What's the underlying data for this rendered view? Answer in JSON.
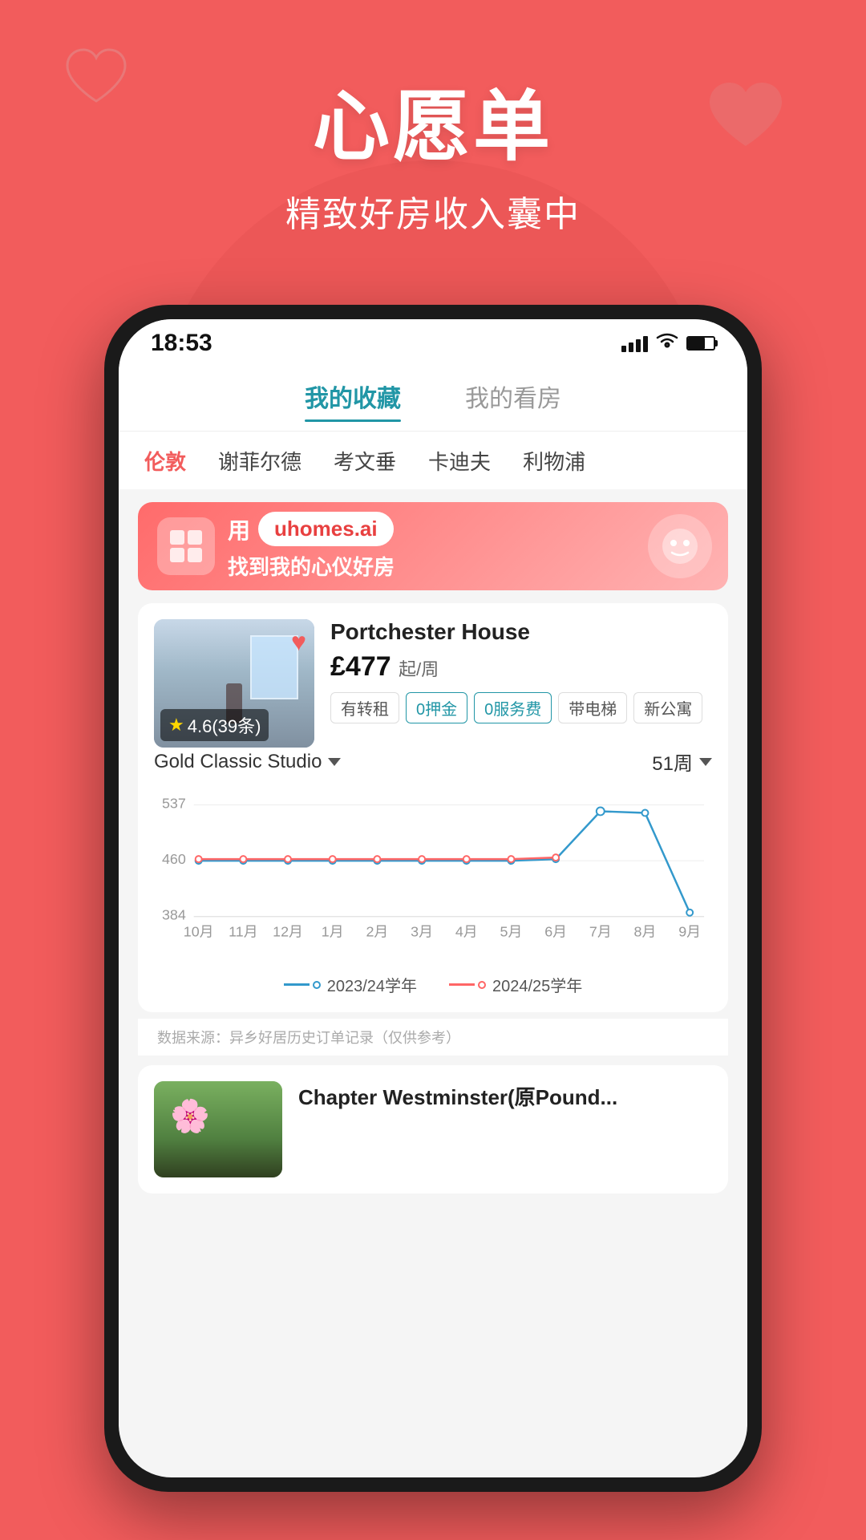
{
  "background_color": "#f25c5c",
  "header": {
    "title": "心愿单",
    "subtitle": "精致好房收入囊中"
  },
  "phone": {
    "status_bar": {
      "time": "18:53"
    },
    "tabs": [
      {
        "label": "我的收藏",
        "active": true
      },
      {
        "label": "我的看房",
        "active": false
      }
    ],
    "cities": [
      {
        "label": "伦敦",
        "active": true
      },
      {
        "label": "谢菲尔德",
        "active": false
      },
      {
        "label": "考文垂",
        "active": false
      },
      {
        "label": "卡迪夫",
        "active": false
      },
      {
        "label": "利物浦",
        "active": false
      }
    ],
    "banner": {
      "prefix_text": "用",
      "url": "uhomes.ai",
      "suffix_text": "找到我的心仪好房"
    },
    "property1": {
      "name": "Portchester House",
      "price": "£477",
      "price_suffix": "起/周",
      "rating": "4.6(39条)",
      "tags": [
        "有转租",
        "0押金",
        "0服务费",
        "带电梯",
        "新公寓"
      ],
      "room_type": "Gold Classic Studio",
      "week_count": "51周",
      "y_max": "537",
      "y_mid": "460",
      "y_min": "384",
      "x_labels": [
        "10月",
        "11月",
        "12月",
        "1月",
        "2月",
        "3月",
        "4月",
        "5月",
        "6月",
        "7月",
        "8月",
        "9月"
      ],
      "legend_2324": "2023/24学年",
      "legend_2425": "2024/25学年",
      "data_source_note": "数据来源：异乡好居历史订单记录（仅供参考）"
    },
    "property2": {
      "name": "Chapter Westminster(原Pound..."
    }
  }
}
